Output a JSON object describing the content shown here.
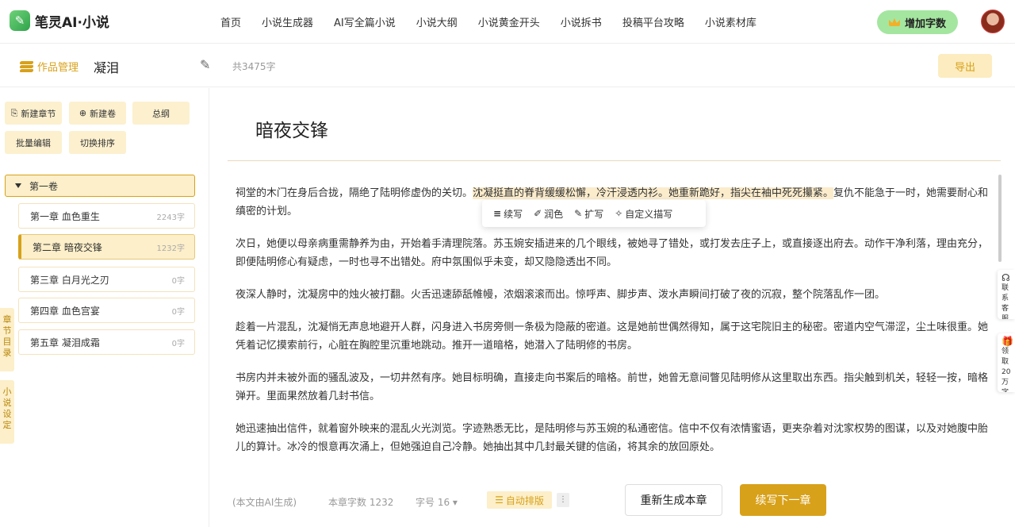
{
  "app": {
    "name": "笔灵AI·小说"
  },
  "nav": [
    "首页",
    "小说生成器",
    "AI写全篇小说",
    "小说大纲",
    "小说黄金开头",
    "小说拆书",
    "投稿平台攻略",
    "小说素材库"
  ],
  "add_words_label": "增加字数",
  "workbar": {
    "works_label": "作品管理",
    "book_title": "凝泪",
    "total_words": "共3475字",
    "export_label": "导出"
  },
  "toolbar": {
    "new_chapter": "新建章节",
    "new_volume": "新建卷",
    "outline": "总纲",
    "batch_edit": "批量编辑",
    "switch_order": "切换排序"
  },
  "volume": {
    "label": "第一卷"
  },
  "chapters": [
    {
      "title": "第一章 血色重生",
      "count": "2243字"
    },
    {
      "title": "第二章 暗夜交锋",
      "count": "1232字"
    },
    {
      "title": "第三章 白月光之刃",
      "count": "0字"
    },
    {
      "title": "第四章 血色宫宴",
      "count": "0字"
    },
    {
      "title": "第五章 凝泪成霜",
      "count": "0字"
    }
  ],
  "side_tabs": {
    "toc": "章节目录",
    "settings": "小说设定"
  },
  "editor": {
    "chapter_title": "暗夜交锋",
    "p1_before": "祠堂的木门在身后合拢，隔绝了陆明修虚伪的关切。",
    "p1_highlight": "沈凝挺直的脊背缓缓松懈，冷汗浸透内衫。她重新跪好，指尖在袖中死死攥紧。",
    "p1_after": "复仇不能急于一时，她需要耐心和缜密的计划。",
    "p2": "次日，她便以母亲病重需静养为由，开始着手清理院落。苏玉婉安插进来的几个眼线，被她寻了错处，或打发去庄子上，或直接逐出府去。动作干净利落，理由充分，即便陆明修心有疑虑，一时也寻不出错处。府中氛围似乎未变，却又隐隐透出不同。",
    "p3": "夜深人静时，沈凝房中的烛火被打翻。火舌迅速舔舐帷幔，浓烟滚滚而出。惊呼声、脚步声、泼水声瞬间打破了夜的沉寂，整个院落乱作一团。",
    "p4": "趁着一片混乱，沈凝悄无声息地避开人群，闪身进入书房旁侧一条极为隐蔽的密道。这是她前世偶然得知，属于这宅院旧主的秘密。密道内空气滞涩，尘土味很重。她凭着记忆摸索前行，心脏在胸腔里沉重地跳动。推开一道暗格，她潜入了陆明修的书房。",
    "p5": "书房内并未被外面的骚乱波及，一切井然有序。她目标明确，直接走向书案后的暗格。前世，她曾无意间瞥见陆明修从这里取出东西。指尖触到机关，轻轻一按，暗格弹开。里面果然放着几封书信。",
    "p6": "她迅速抽出信件，就着窗外映来的混乱火光浏览。字迹熟悉无比，是陆明修与苏玉婉的私通密信。信中不仅有浓情蜜语，更夹杂着对沈家权势的图谋，以及对她腹中胎儿的算计。冰冷的恨意再次涌上，但她强迫自己冷静。她抽出其中几封最关键的信函，将其余的放回原处。"
  },
  "popup": {
    "continue": "续写",
    "polish": "润色",
    "expand": "扩写",
    "custom": "自定义描写"
  },
  "right_float": {
    "service": "联系客服",
    "gift": "领取20万字数"
  },
  "bottom": {
    "ai_note": "(本文由AI生成)",
    "chapter_words": "本章字数 1232",
    "font_size": "字号 16",
    "auto_format": "自动排版",
    "regenerate": "重新生成本章",
    "next_chapter": "续写下一章"
  }
}
